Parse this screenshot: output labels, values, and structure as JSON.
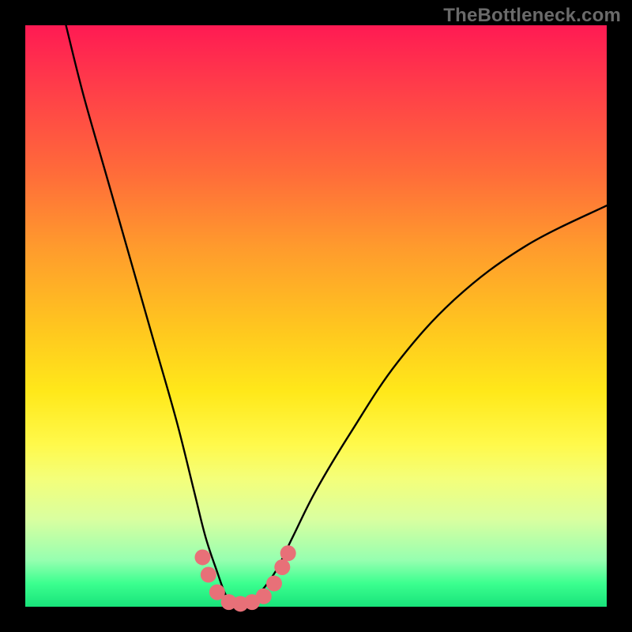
{
  "watermark": "TheBottleneck.com",
  "chart_data": {
    "type": "line",
    "title": "",
    "xlabel": "",
    "ylabel": "",
    "xlim": [
      0,
      100
    ],
    "ylim": [
      0,
      100
    ],
    "grid": false,
    "series": [
      {
        "name": "bottleneck-curve",
        "x": [
          7,
          10,
          14,
          18,
          22,
          26,
          29,
          31,
          33,
          34.5,
          36,
          38,
          40,
          43,
          46,
          50,
          56,
          64,
          74,
          86,
          100
        ],
        "y": [
          100,
          88,
          74,
          60,
          46,
          32,
          20,
          12,
          6,
          2,
          0.5,
          0.5,
          2,
          6,
          12,
          20,
          30,
          42,
          53,
          62,
          69
        ],
        "color": "#000000"
      }
    ],
    "markers": {
      "name": "highlight-dots",
      "color": "#e87078",
      "points": [
        {
          "x": 30.5,
          "y": 8.5
        },
        {
          "x": 31.5,
          "y": 5.5
        },
        {
          "x": 33.0,
          "y": 2.5
        },
        {
          "x": 35.0,
          "y": 0.8
        },
        {
          "x": 37.0,
          "y": 0.5
        },
        {
          "x": 39.0,
          "y": 0.8
        },
        {
          "x": 41.0,
          "y": 1.8
        },
        {
          "x": 42.8,
          "y": 4.0
        },
        {
          "x": 44.2,
          "y": 6.8
        },
        {
          "x": 45.2,
          "y": 9.2
        }
      ]
    }
  }
}
